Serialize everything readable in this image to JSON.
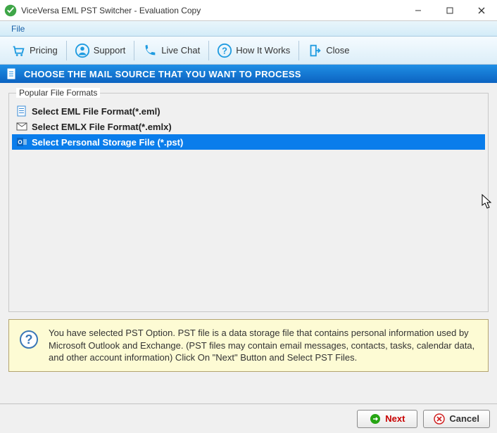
{
  "window": {
    "title": "ViceVersa EML PST Switcher - Evaluation Copy"
  },
  "menubar": {
    "file": "File"
  },
  "toolbar": {
    "pricing": "Pricing",
    "support": "Support",
    "live_chat": "Live Chat",
    "how_it_works": "How It Works",
    "close": "Close"
  },
  "section_header": "CHOOSE THE MAIL SOURCE THAT YOU WANT TO PROCESS",
  "group_legend": "Popular File Formats",
  "formats": {
    "eml": "Select EML File Format(*.eml)",
    "emlx": "Select EMLX File Format(*.emlx)",
    "pst": "Select Personal Storage File (*.pst)"
  },
  "selected_format": "pst",
  "info_text": "You have selected PST Option. PST file is a data storage file that contains personal information used by Microsoft Outlook and Exchange. (PST files may contain email messages, contacts, tasks, calendar data, and other account information) Click On \"Next\" Button and Select PST Files.",
  "footer": {
    "next": "Next",
    "cancel": "Cancel"
  }
}
